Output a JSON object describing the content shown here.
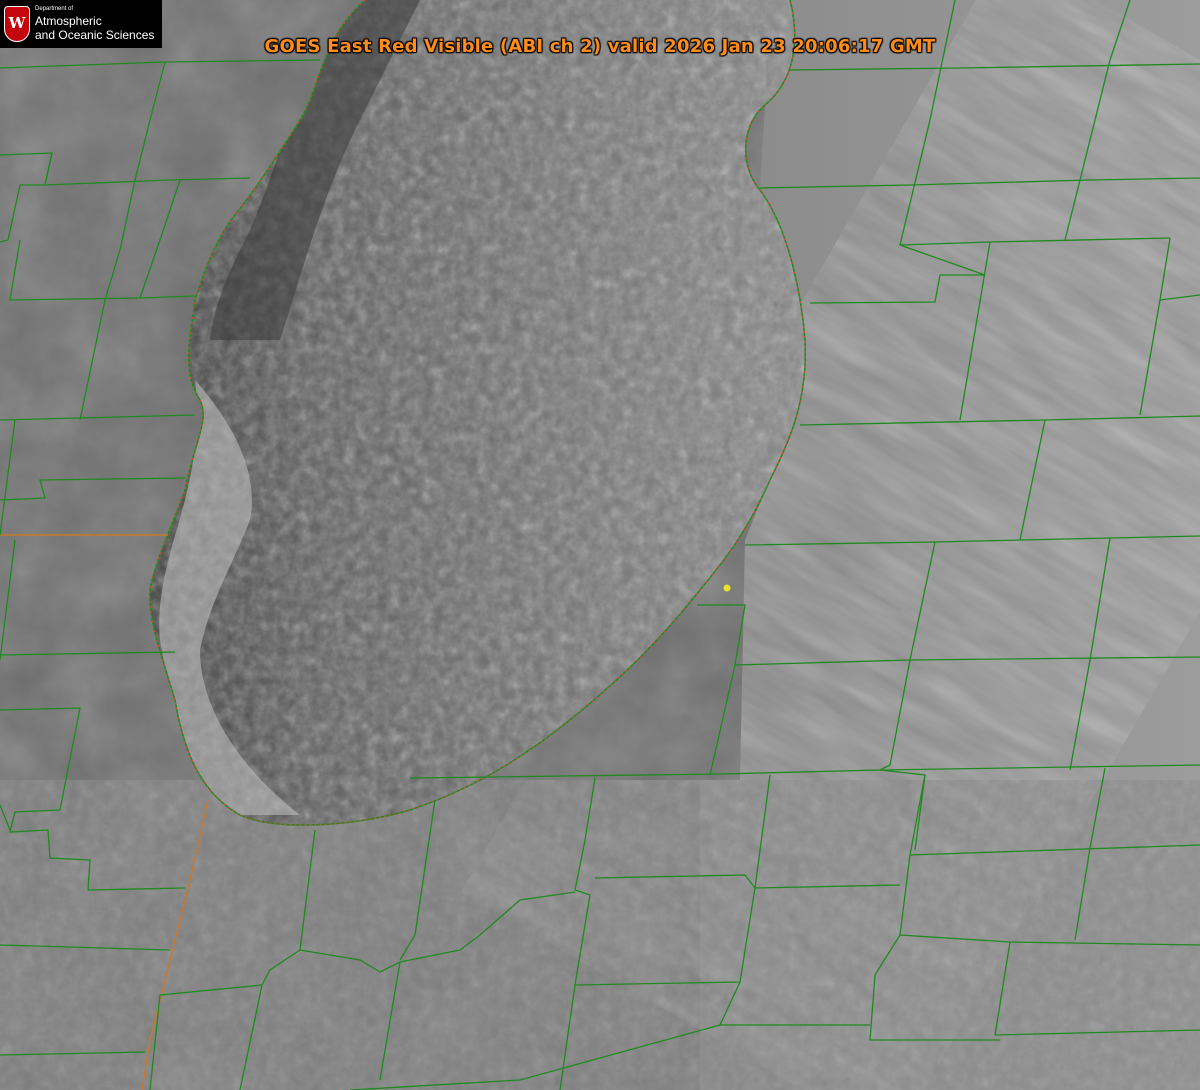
{
  "title": "GOES East Red Visible (ABI ch 2) valid 2026 Jan 23 20:06:17 GMT",
  "logo": {
    "crest_letter": "W",
    "department": "Department of",
    "line1": "Atmospheric",
    "line2": "and Oceanic Sciences"
  },
  "colors": {
    "title": "#ff8c1a",
    "county_lines": "#1f8a1f",
    "state_line": "#c87a2a",
    "shoreline_dotted": "#e0483c",
    "marker": "#e6e22a"
  },
  "map": {
    "content": "Lake Michigan with lake-effect cloud field",
    "marker_icon": "location-dot-icon"
  }
}
